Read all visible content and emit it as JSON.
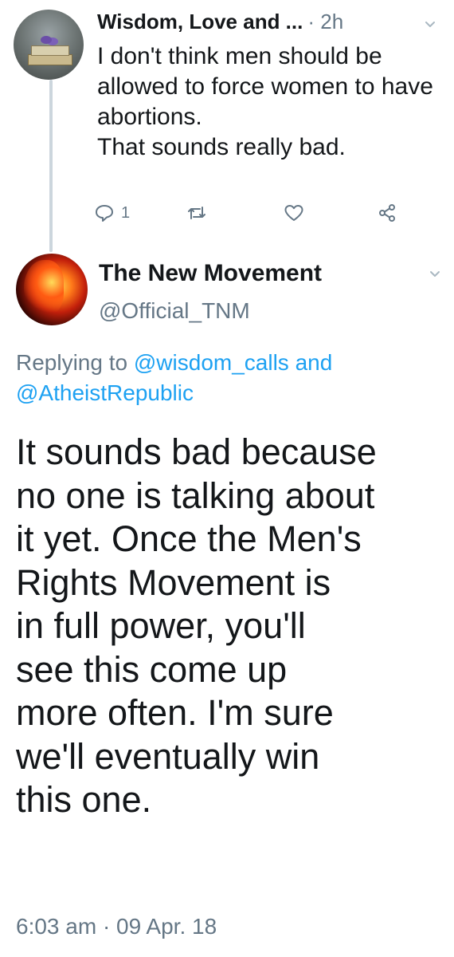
{
  "parent_tweet": {
    "display_name": "Wisdom, Love and ...",
    "time": "· 2h",
    "text": "I don't think men should be allowed to force women to have abortions.\nThat sounds really bad.",
    "reply_count": "1",
    "icons": {
      "reply": "reply-icon",
      "retweet": "retweet-icon",
      "like": "heart-icon",
      "share": "share-icon",
      "more": "chevron-down-icon"
    }
  },
  "main_tweet": {
    "display_name": "The New Movement",
    "handle": "@Official_TNM",
    "replying_prefix": "Replying to",
    "mention_1": "@wisdom_calls",
    "conjunction": "and",
    "mention_2": "@AtheistRepublic",
    "text": "It sounds bad because\nno one is talking about\nit yet. Once the Men's\nRights Movement is\nin full power, you'll\nsee this come up\nmore often. I'm sure\nwe'll eventually win\nthis one.",
    "timestamp": "6:03 am · 09 Apr. 18"
  },
  "colors": {
    "text": "#14171a",
    "muted": "#657786",
    "link": "#1da1f2",
    "thread_line": "#ccd6dd"
  }
}
